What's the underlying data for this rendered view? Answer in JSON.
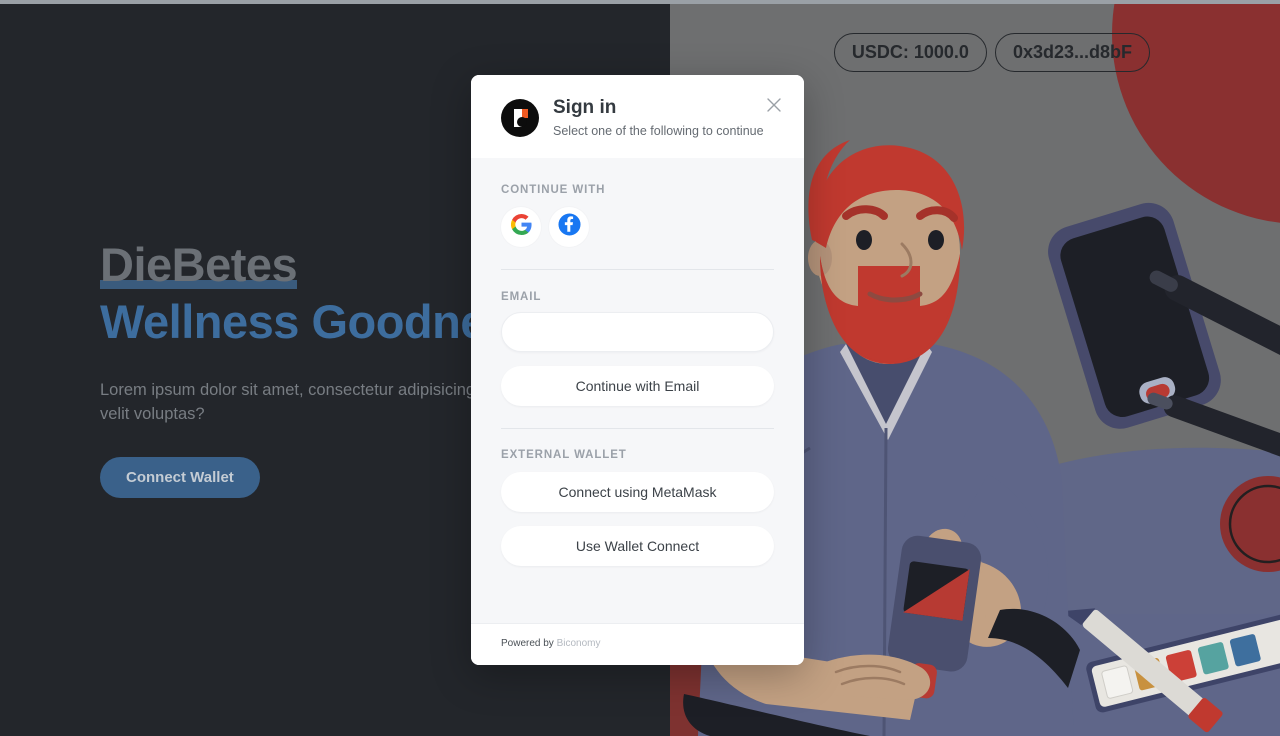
{
  "hero": {
    "title_line1": "DieBetes",
    "title_line2": "Wellness Goodness",
    "subtitle": "Lorem ipsum dolor sit amet, consectetur adipisicing elit. Aliquam error velit voluptas?",
    "cta_label": "Connect Wallet"
  },
  "badges": [
    {
      "label": "USDC: 1000.0"
    },
    {
      "label": "0x3d23...d8bF"
    }
  ],
  "modal": {
    "title": "Sign in",
    "subtitle": "Select one of the following to continue",
    "close_label": "×",
    "continue_with_label": "CONTINUE WITH",
    "socials": [
      {
        "name": "google",
        "label": "Google"
      },
      {
        "name": "facebook",
        "label": "Facebook"
      }
    ],
    "email_label": "EMAIL",
    "email_value": "",
    "email_placeholder": "",
    "email_button": "Continue with Email",
    "external_wallet_label": "EXTERNAL WALLET",
    "metamask_button": "Connect using MetaMask",
    "walletconnect_button": "Use Wallet Connect",
    "powered_prefix": "Powered by ",
    "powered_brand": "Biconomy"
  },
  "colors": {
    "hero_bg": "#23262b",
    "hero_accent": "#3d6d9e",
    "hero_underline": "#3d6286",
    "cta_bg": "#3a618a",
    "modal_bg": "#f6f7f9",
    "art_overlay": "#6e6f70",
    "brand_orange": "#f05a22",
    "illustration_red": "#8a3030",
    "illustration_blue": "#5f6689"
  }
}
